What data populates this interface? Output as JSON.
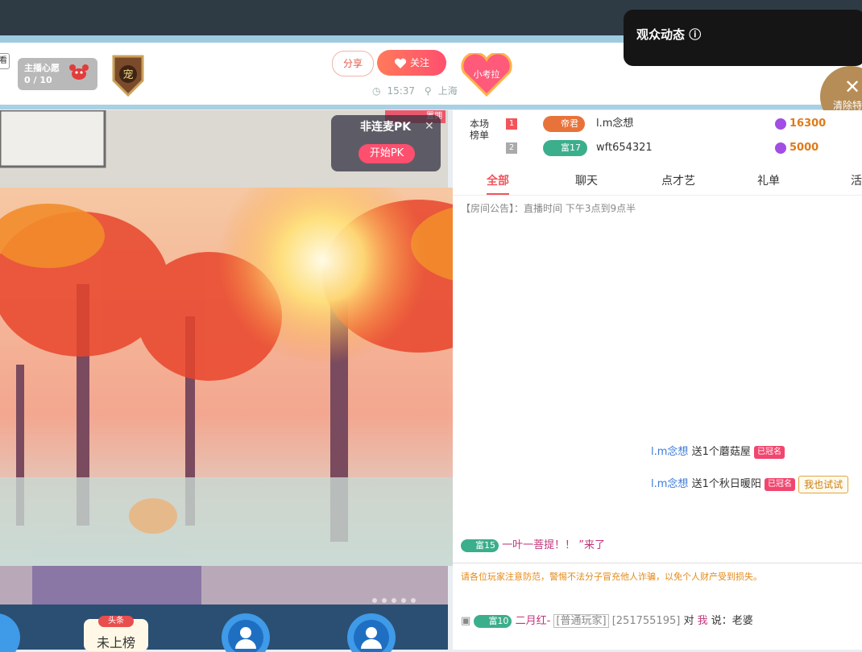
{
  "header": {
    "edge_tag": "看",
    "wish": {
      "title": "主播心愿",
      "count": "0 / 10"
    },
    "pet_badge": "宠",
    "share_label": "分享",
    "follow_label": "关注",
    "time": "15:37",
    "location": "上海",
    "kaola": "小考拉"
  },
  "dynamics": {
    "title": "观众动态 ⓘ"
  },
  "clear_button": {
    "label": "清除特"
  },
  "video": {
    "pk_title": "非连麦PK",
    "pk_close": "✕",
    "pk_start": "开始PK",
    "top_tag": "置拥"
  },
  "bottom_bar": {
    "headline_tag": "头条",
    "unranked": "未上榜"
  },
  "ranking": {
    "label": "本场榜单",
    "rows": [
      {
        "rank": "1",
        "level": "帝君",
        "name": "l.m念想",
        "score": "16300"
      },
      {
        "rank": "2",
        "level": "富17",
        "name": "wft654321",
        "score": "5000"
      }
    ]
  },
  "tabs": [
    "全部",
    "聊天",
    "点才艺",
    "礼单",
    "活动"
  ],
  "chat": {
    "notice": "【房间公告】：直播时间 下午3点到9点半",
    "gift1": {
      "user": "l.m念想",
      "text": "送1个蘑菇屋",
      "chip": "已冠名"
    },
    "gift2": {
      "user": "l.m念想",
      "text": "送1个秋日暖阳",
      "chip": "已冠名",
      "try": "我也试试"
    },
    "msg1": {
      "level": "富15",
      "text": "一叶一菩提！！ ”来了"
    },
    "warning": "请各位玩家注意防范，警惕不法分子冒充他人诈骗，以免个人财产受到损失。",
    "msg2": {
      "level": "富10",
      "user": "二月红-",
      "role": "[普通玩家]",
      "id": "[251755195]",
      "to": "对",
      "me": "我",
      "says": "说：老婆"
    }
  },
  "colors": {
    "accent": "#f2545b",
    "topbar": "#2e3b45",
    "stripe": "#9fcbe0"
  }
}
